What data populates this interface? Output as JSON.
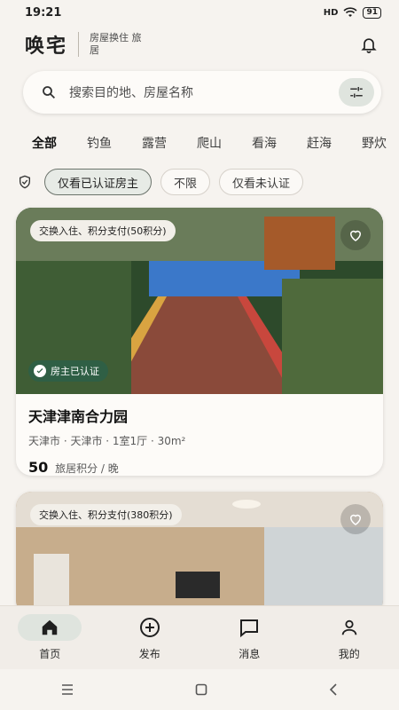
{
  "status": {
    "time": "19:21",
    "network": "HD",
    "battery": "91"
  },
  "header": {
    "logo": "唤宅",
    "tagline": "房屋换住 旅居"
  },
  "search": {
    "placeholder": "搜索目的地、房屋名称"
  },
  "tabs": [
    {
      "label": "全部"
    },
    {
      "label": "钓鱼"
    },
    {
      "label": "露营"
    },
    {
      "label": "爬山"
    },
    {
      "label": "看海"
    },
    {
      "label": "赶海"
    },
    {
      "label": "野炊"
    }
  ],
  "filters": {
    "chips": [
      {
        "label": "仅看已认证房主"
      },
      {
        "label": "不限"
      },
      {
        "label": "仅看未认证"
      }
    ]
  },
  "listings": [
    {
      "badge": "交换入住、积分支付(50积分)",
      "verified": "房主已认证",
      "title": "天津津南合力园",
      "subtitle": "天津市 · 天津市 · 1室1厅 · 30m²",
      "price": "50",
      "price_unit": "旅居积分 / 晚"
    },
    {
      "badge": "交换入住、积分支付(380积分)"
    }
  ],
  "bottom_nav": [
    {
      "label": "首页",
      "icon": "home-icon"
    },
    {
      "label": "发布",
      "icon": "add-circle-icon"
    },
    {
      "label": "消息",
      "icon": "message-icon"
    },
    {
      "label": "我的",
      "icon": "person-icon"
    }
  ],
  "colors": {
    "accent_chip": "#dfe4de",
    "verified_badge": "#2f5f45",
    "background": "#f6f3ef"
  }
}
